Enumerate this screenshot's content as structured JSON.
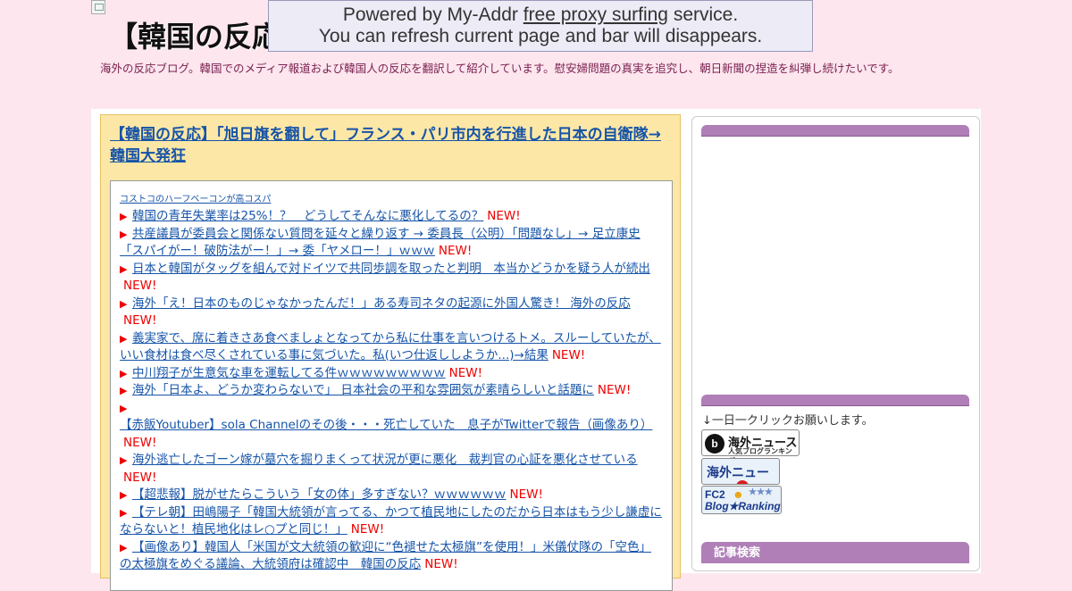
{
  "header": {
    "title": "【韓国の反応",
    "description": "海外の反応ブログ。韓国でのメディア報道および韓国人の反応を翻訳して紹介しています。慰安婦問題の真実を追究し、朝日新聞の捏造を糾弾し続けたいです。"
  },
  "proxy_bar": {
    "line1_before": "Powered by My-Addr ",
    "line1_link": "free proxy surfing",
    "line1_after": " service.",
    "line2": "You can refresh current page and bar will disappears."
  },
  "main": {
    "entry_title": "【韓国の反応】「旭日旗を翻して」フランス・パリ市内を行進した日本の自衛隊→韓国大発狂",
    "ad_link": "コストコのハーフベーコンが高コスパ",
    "new_label": "NEW!",
    "items": [
      "韓国の青年失業率は25%！？　どうしてそんなに悪化してるの？",
      "共産議員が委員会と関係ない質問を延々と繰り返す → 委員長（公明）「問題なし」→ 足立康史「スパイがー！破防法がー！」→ 委「ヤメロー！」ｗｗｗ",
      "日本と韓国がタッグを組んで対ドイツで共同歩調を取ったと判明　本当かどうかを疑う人が続出",
      "海外「え！日本のものじゃなかったんだ！」ある寿司ネタの起源に外国人驚き！ 海外の反応",
      "義実家で、席に着きさあ食べましょとなってから私に仕事を言いつけるトメ。スルーしていたが、いい食材は食べ尽くされている事に気づいた。私(いつ仕返ししようか...)→結果",
      "中川翔子が生意気な車を運転してる件ｗｗｗｗｗｗｗｗｗ",
      "海外「日本よ、どうか変わらないで」 日本社会の平和な雰囲気が素晴らしいと話題に",
      "【赤飯Youtuber】sola Channelのその後・・・死亡していた　息子がTwitterで報告（画像あり）",
      "海外逃亡したゴーン嫁が墓穴を掘りまくって状況が更に悪化　裁判官の心証を悪化させている",
      "【超悲報】脱がせたらこういう「女の体」多すぎない？ｗｗｗｗｗｗ",
      "【テレ朝】田嶋陽子「韓国大統領が言ってる、かつて植民地にしたのだから日本はもう少し謙虚にならないと！植民地化はレ○プと同じ！」",
      "【画像あり】韓国人「米国が文大統領の歓迎に“色褪せた太極旗”を使用！」米儀仗隊の「空色」の太極旗をめぐる議論、大統領府は確認中　韓国の反応"
    ]
  },
  "sidebar": {
    "click_note": "↓一日一クリックお願いします。",
    "badge1_line1": "海外ニュース",
    "badge1_line2": "人気ブログランキング",
    "badge2_label": "海外ニュース",
    "badge3_line1": "FC2",
    "badge3_line2": "Blog★Ranking",
    "search_heading": "記事検索"
  }
}
